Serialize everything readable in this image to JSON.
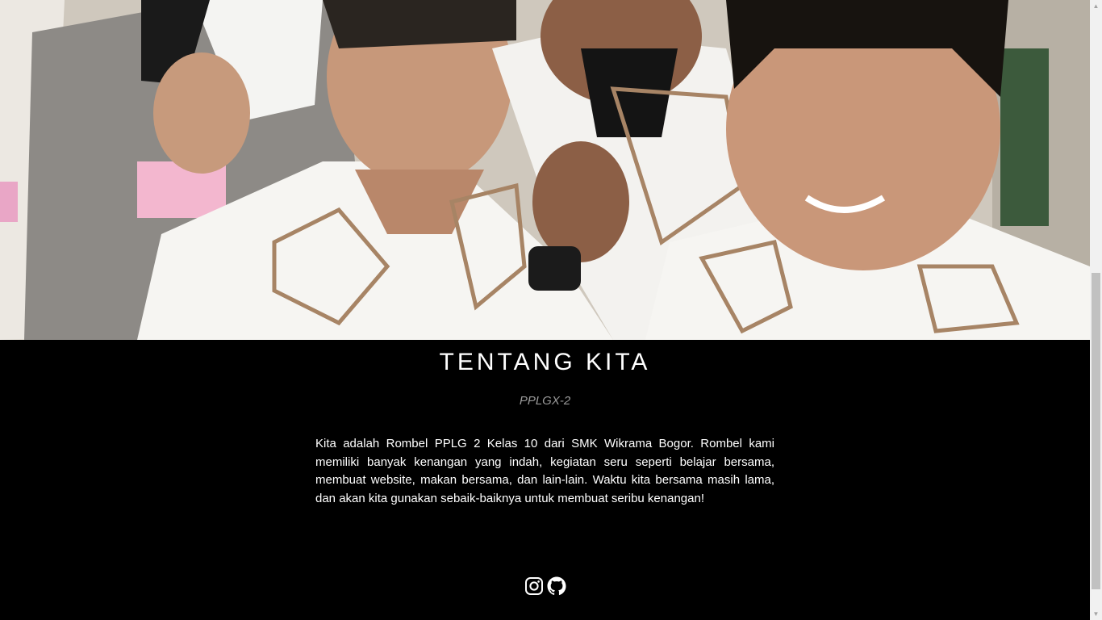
{
  "hero": {
    "image": "group-photo"
  },
  "about": {
    "title": "TENTANG KITA",
    "subtitle": "PPLGX-2",
    "description": "Kita adalah Rombel PPLG 2 Kelas 10 dari SMK Wikrama Bogor. Rombel kami memiliki banyak kenangan yang indah, kegiatan seru seperti belajar bersama, membuat website, makan bersama, dan lain-lain. Waktu kita bersama masih lama, dan akan kita gunakan sebaik-baiknya untuk membuat seribu kenangan!"
  },
  "socials": [
    {
      "icon": "instagram-icon"
    },
    {
      "icon": "github-icon"
    }
  ],
  "scrollbar": {
    "up_arrow": "▲",
    "down_arrow": "▼"
  },
  "colors": {
    "background": "#000000",
    "text": "#ffffff",
    "subtitle": "#9a9a9a"
  }
}
